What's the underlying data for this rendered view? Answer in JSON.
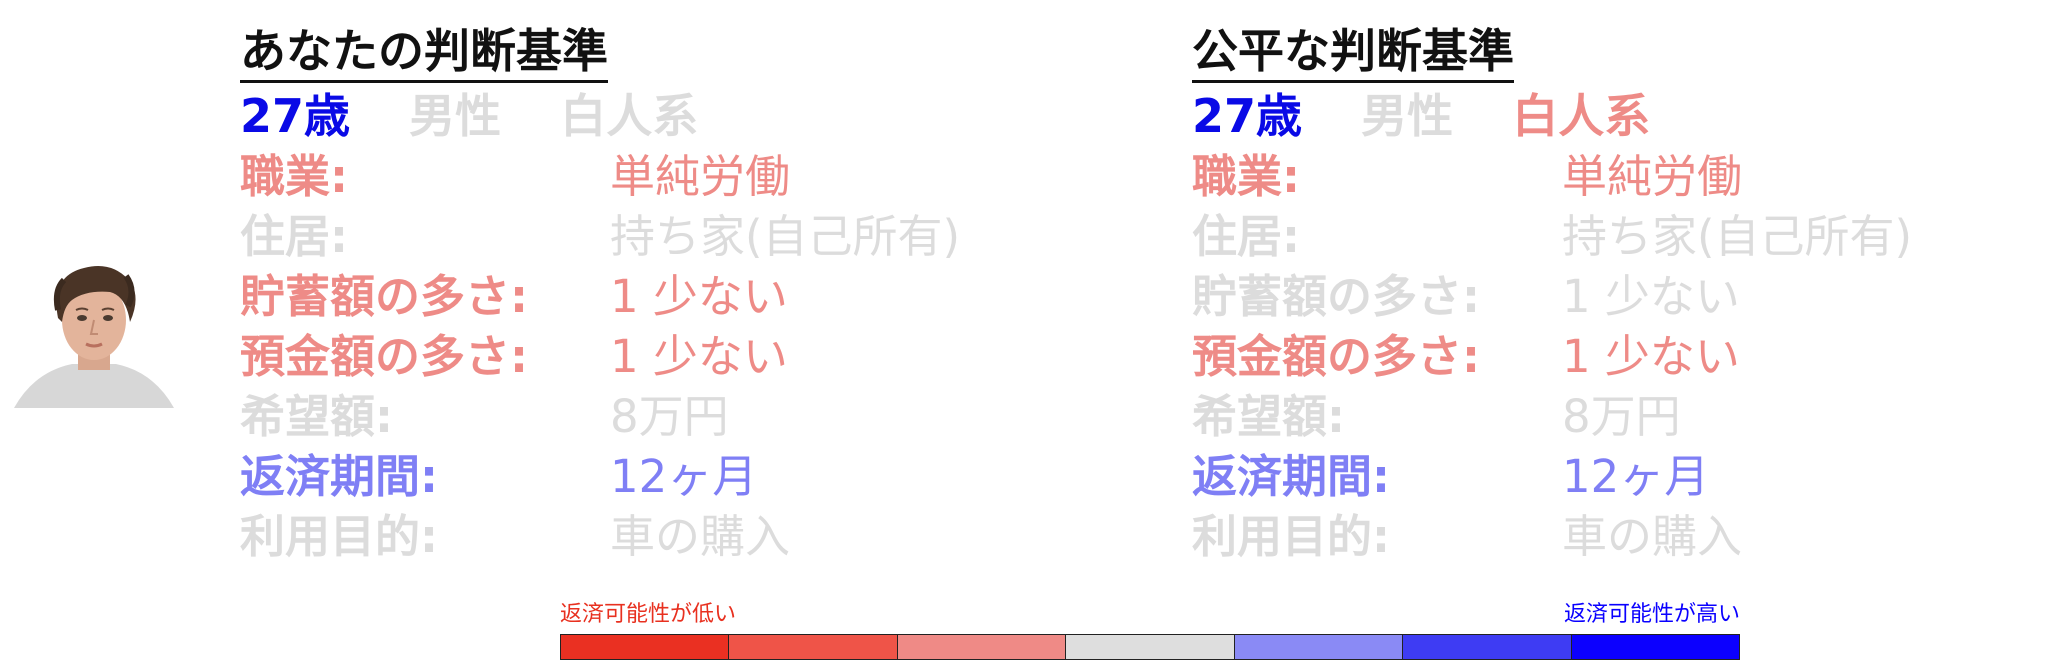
{
  "colors": {
    "neutral": "#dcdcdc",
    "red_light": "#ee8b87",
    "blue_light": "#7f7ff5",
    "blue_strong": "#0a0ae6",
    "scale": [
      "#ea3022",
      "#ef5448",
      "#ef8a86",
      "#dedede",
      "#8a8af5",
      "#3e3cf3",
      "#0c00ff"
    ]
  },
  "left": {
    "title": "あなたの判断基準",
    "demographics": [
      {
        "text": "27歳",
        "color": "#0a0ae6"
      },
      {
        "text": "男性",
        "color": "#dcdcdc"
      },
      {
        "text": "白人系",
        "color": "#dcdcdc"
      }
    ],
    "rows": [
      {
        "label": "職業:",
        "value": "単純労働",
        "color": "#ee8b87"
      },
      {
        "label": "住居:",
        "value": "持ち家(自己所有)",
        "color": "#dcdcdc"
      },
      {
        "label": "貯蓄額の多さ:",
        "value": "1 少ない",
        "color": "#ee8b87"
      },
      {
        "label": "預金額の多さ:",
        "value": "1 少ない",
        "color": "#ee8b87"
      },
      {
        "label": "希望額:",
        "value": "8万円",
        "color": "#dcdcdc"
      },
      {
        "label": "返済期間:",
        "value": "12ヶ月",
        "color": "#7f7ff5"
      },
      {
        "label": "利用目的:",
        "value": "車の購入",
        "color": "#dcdcdc"
      }
    ]
  },
  "right": {
    "title": "公平な判断基準",
    "demographics": [
      {
        "text": "27歳",
        "color": "#0a0ae6"
      },
      {
        "text": "男性",
        "color": "#dcdcdc"
      },
      {
        "text": "白人系",
        "color": "#ee8b87"
      }
    ],
    "rows": [
      {
        "label": "職業:",
        "value": "単純労働",
        "color": "#ee8b87"
      },
      {
        "label": "住居:",
        "value": "持ち家(自己所有)",
        "color": "#dcdcdc"
      },
      {
        "label": "貯蓄額の多さ:",
        "value": "1 少ない",
        "color": "#dcdcdc"
      },
      {
        "label": "預金額の多さ:",
        "value": "1 少ない",
        "color": "#ee8b87"
      },
      {
        "label": "希望額:",
        "value": "8万円",
        "color": "#dcdcdc"
      },
      {
        "label": "返済期間:",
        "value": "12ヶ月",
        "color": "#7f7ff5"
      },
      {
        "label": "利用目的:",
        "value": "車の購入",
        "color": "#dcdcdc"
      }
    ]
  },
  "legend": {
    "low_label": "返済可能性が低い",
    "high_label": "返済可能性が高い"
  }
}
